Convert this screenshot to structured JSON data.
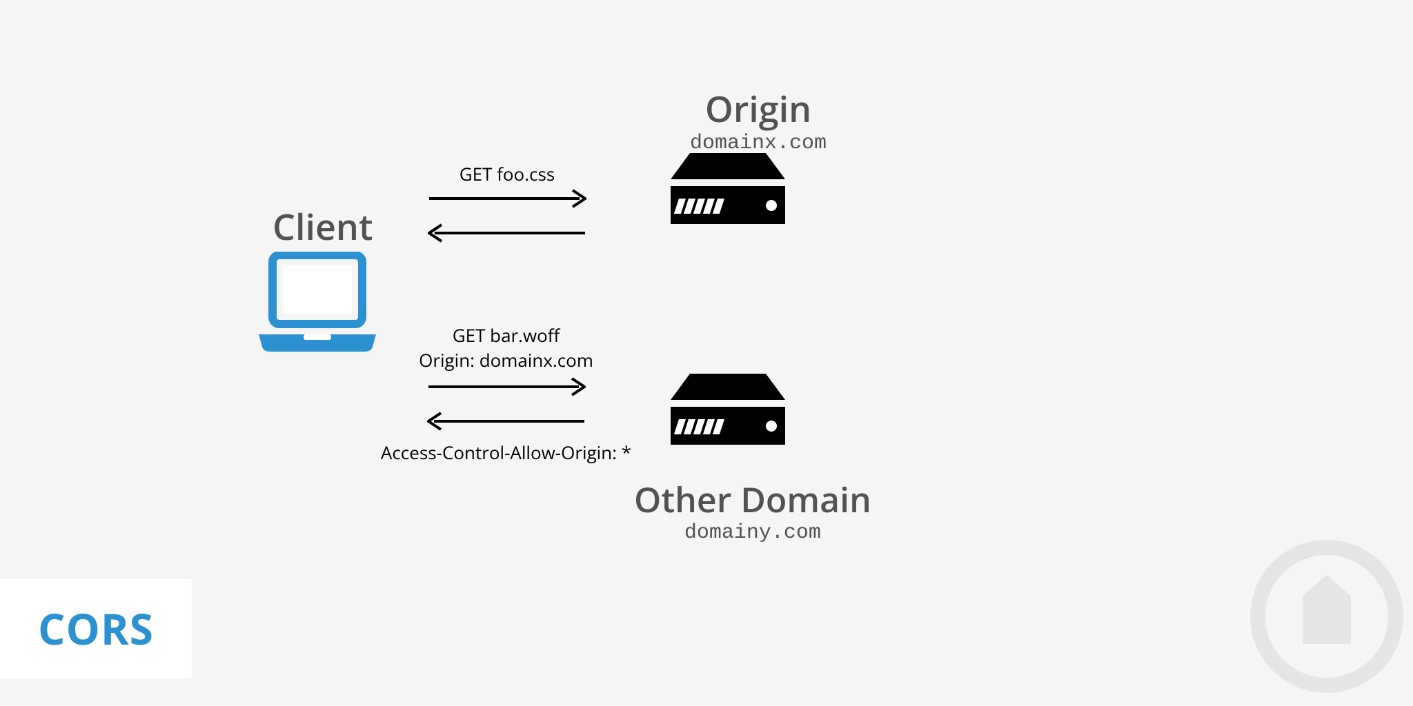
{
  "badge": "CORS",
  "client": {
    "label": "Client"
  },
  "origin": {
    "title": "Origin",
    "sub": "domainx.com"
  },
  "other": {
    "title": "Other Domain",
    "sub": "domainy.com"
  },
  "req1": {
    "label": "GET foo.css"
  },
  "req2": {
    "line1": "GET bar.woff",
    "line2": "Origin: domainx.com"
  },
  "resp2": {
    "label": "Access-Control-Allow-Origin: *"
  },
  "colors": {
    "accent": "#2b91d1",
    "text": "#525252"
  }
}
